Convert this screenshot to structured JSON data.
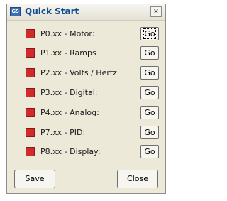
{
  "window": {
    "title": "Quick Start",
    "icon_label": "GS",
    "close_label": "×"
  },
  "params": [
    {
      "label": "P0.xx - Motor:",
      "button": "Go",
      "focused": true
    },
    {
      "label": "P1.xx - Ramps",
      "button": "Go"
    },
    {
      "label": "P2.xx - Volts / Hertz",
      "button": "Go"
    },
    {
      "label": "P3.xx - Digital:",
      "button": "Go"
    },
    {
      "label": "P4.xx - Analog:",
      "button": "Go"
    },
    {
      "label": "P7.xx - PID:",
      "button": "Go"
    },
    {
      "label": "P8.xx - Display:",
      "button": "Go"
    }
  ],
  "footer": {
    "save_label": "Save",
    "close_label": "Close"
  },
  "colors": {
    "indicator": "#d22a2a",
    "title_text": "#0e4c91",
    "window_bg": "#ece9d8"
  }
}
